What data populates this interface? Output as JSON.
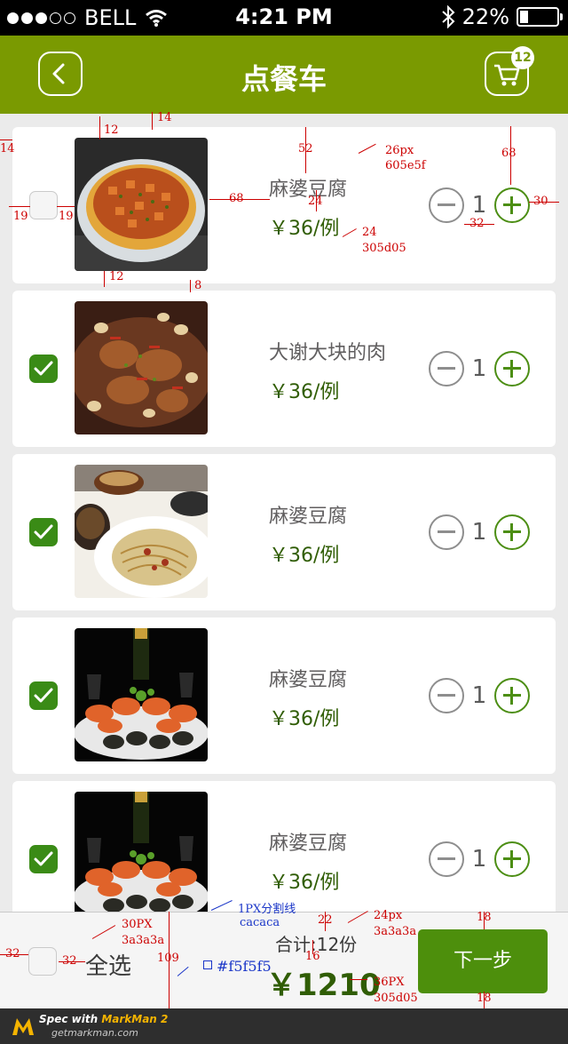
{
  "status_bar": {
    "carrier": "BELL",
    "time": "4:21 PM",
    "battery": "22%"
  },
  "header": {
    "title": "点餐车",
    "cart_count": "12"
  },
  "items": [
    {
      "name": "麻婆豆腐",
      "price": "￥36/例",
      "qty": "1",
      "checked": false,
      "image": "mapo-tofu"
    },
    {
      "name": "大谢大块的肉",
      "price": "￥36/例",
      "qty": "1",
      "checked": true,
      "image": "braised-meat"
    },
    {
      "name": "麻婆豆腐",
      "price": "￥36/例",
      "qty": "1",
      "checked": true,
      "image": "noodles-table"
    },
    {
      "name": "麻婆豆腐",
      "price": "￥36/例",
      "qty": "1",
      "checked": true,
      "image": "seafood-platter"
    },
    {
      "name": "麻婆豆腐",
      "price": "￥36/例",
      "qty": "1",
      "checked": true,
      "image": "seafood-platter"
    }
  ],
  "bottom_bar": {
    "select_all": "全选",
    "total": "合计:12份",
    "amount": "￥1210",
    "next": "下一步"
  },
  "footer": {
    "brand_prefix": "Spec with",
    "brand_name": "MarkMan 2",
    "url": "getmarkman.com"
  },
  "annotations": {
    "a_14_top": "14",
    "a_12_top": "12",
    "a_14_left": "14",
    "a_52": "52",
    "a_name_spec": "26px",
    "a_name_color": "605e5f",
    "a_68_top": "68",
    "a_19_left": "19",
    "a_19_right": "19",
    "a_68_gap": "68",
    "a_24_gap": "24",
    "a_price_spec": "24",
    "a_price_color": "305d05",
    "a_32": "32",
    "a_30": "30",
    "a_12_bottom": "12",
    "a_8": "8",
    "a_divider": "1PX分割线",
    "a_divider_color": "cacaca",
    "a_selall_spec": "30PX",
    "a_selall_color": "3a3a3a",
    "a_22": "22",
    "a_total_spec": "24px",
    "a_total_color": "3a3a3a",
    "a_18_top": "18",
    "a_32_left": "32",
    "a_32_right": "32",
    "a_109": "109",
    "a_bg": "#f5f5f5",
    "a_16": "16",
    "a_amount_spec": "36PX",
    "a_amount_color": "305d05",
    "a_18_bottom": "18"
  }
}
